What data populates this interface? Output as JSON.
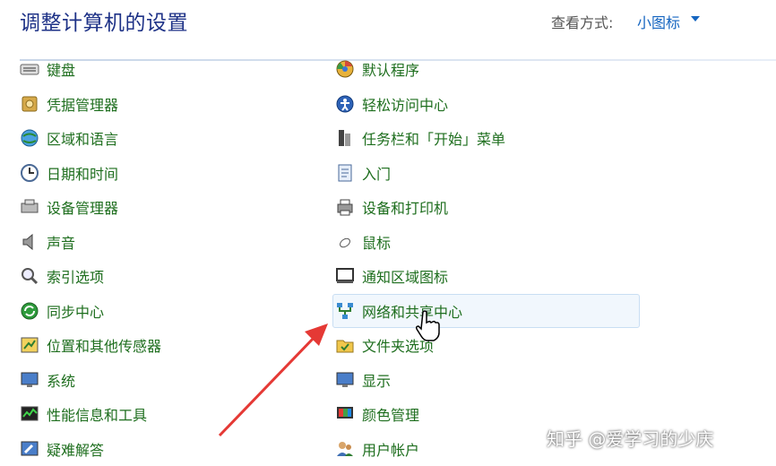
{
  "header": {
    "title": "调整计算机的设置",
    "view_label": "查看方式:",
    "view_value": "小图标"
  },
  "left_items": [
    {
      "label": "键盘",
      "icon": "keyboard-icon"
    },
    {
      "label": "凭据管理器",
      "icon": "credential-manager-icon"
    },
    {
      "label": "区域和语言",
      "icon": "region-language-icon"
    },
    {
      "label": "日期和时间",
      "icon": "date-time-icon"
    },
    {
      "label": "设备管理器",
      "icon": "device-manager-icon"
    },
    {
      "label": "声音",
      "icon": "sound-icon"
    },
    {
      "label": "索引选项",
      "icon": "indexing-options-icon"
    },
    {
      "label": "同步中心",
      "icon": "sync-center-icon"
    },
    {
      "label": "位置和其他传感器",
      "icon": "location-sensors-icon"
    },
    {
      "label": "系统",
      "icon": "system-icon"
    },
    {
      "label": "性能信息和工具",
      "icon": "performance-icon"
    },
    {
      "label": "疑难解答",
      "icon": "troubleshooting-icon"
    }
  ],
  "right_items": [
    {
      "label": "默认程序",
      "icon": "default-programs-icon"
    },
    {
      "label": "轻松访问中心",
      "icon": "ease-of-access-icon"
    },
    {
      "label": "任务栏和「开始」菜单",
      "icon": "taskbar-start-menu-icon"
    },
    {
      "label": "入门",
      "icon": "getting-started-icon"
    },
    {
      "label": "设备和打印机",
      "icon": "devices-printers-icon"
    },
    {
      "label": "鼠标",
      "icon": "mouse-icon"
    },
    {
      "label": "通知区域图标",
      "icon": "notification-area-icon"
    },
    {
      "label": "网络和共享中心",
      "icon": "network-sharing-icon",
      "highlighted": true
    },
    {
      "label": "文件夹选项",
      "icon": "folder-options-icon"
    },
    {
      "label": "显示",
      "icon": "display-icon"
    },
    {
      "label": "颜色管理",
      "icon": "color-management-icon"
    },
    {
      "label": "用户帐户",
      "icon": "user-accounts-icon"
    }
  ],
  "watermark": "知乎 @爱学习的少庆",
  "colors": {
    "title": "#1e3287",
    "link": "#1e6e1e",
    "view": "#1565c0",
    "arrow": "#e53935"
  }
}
